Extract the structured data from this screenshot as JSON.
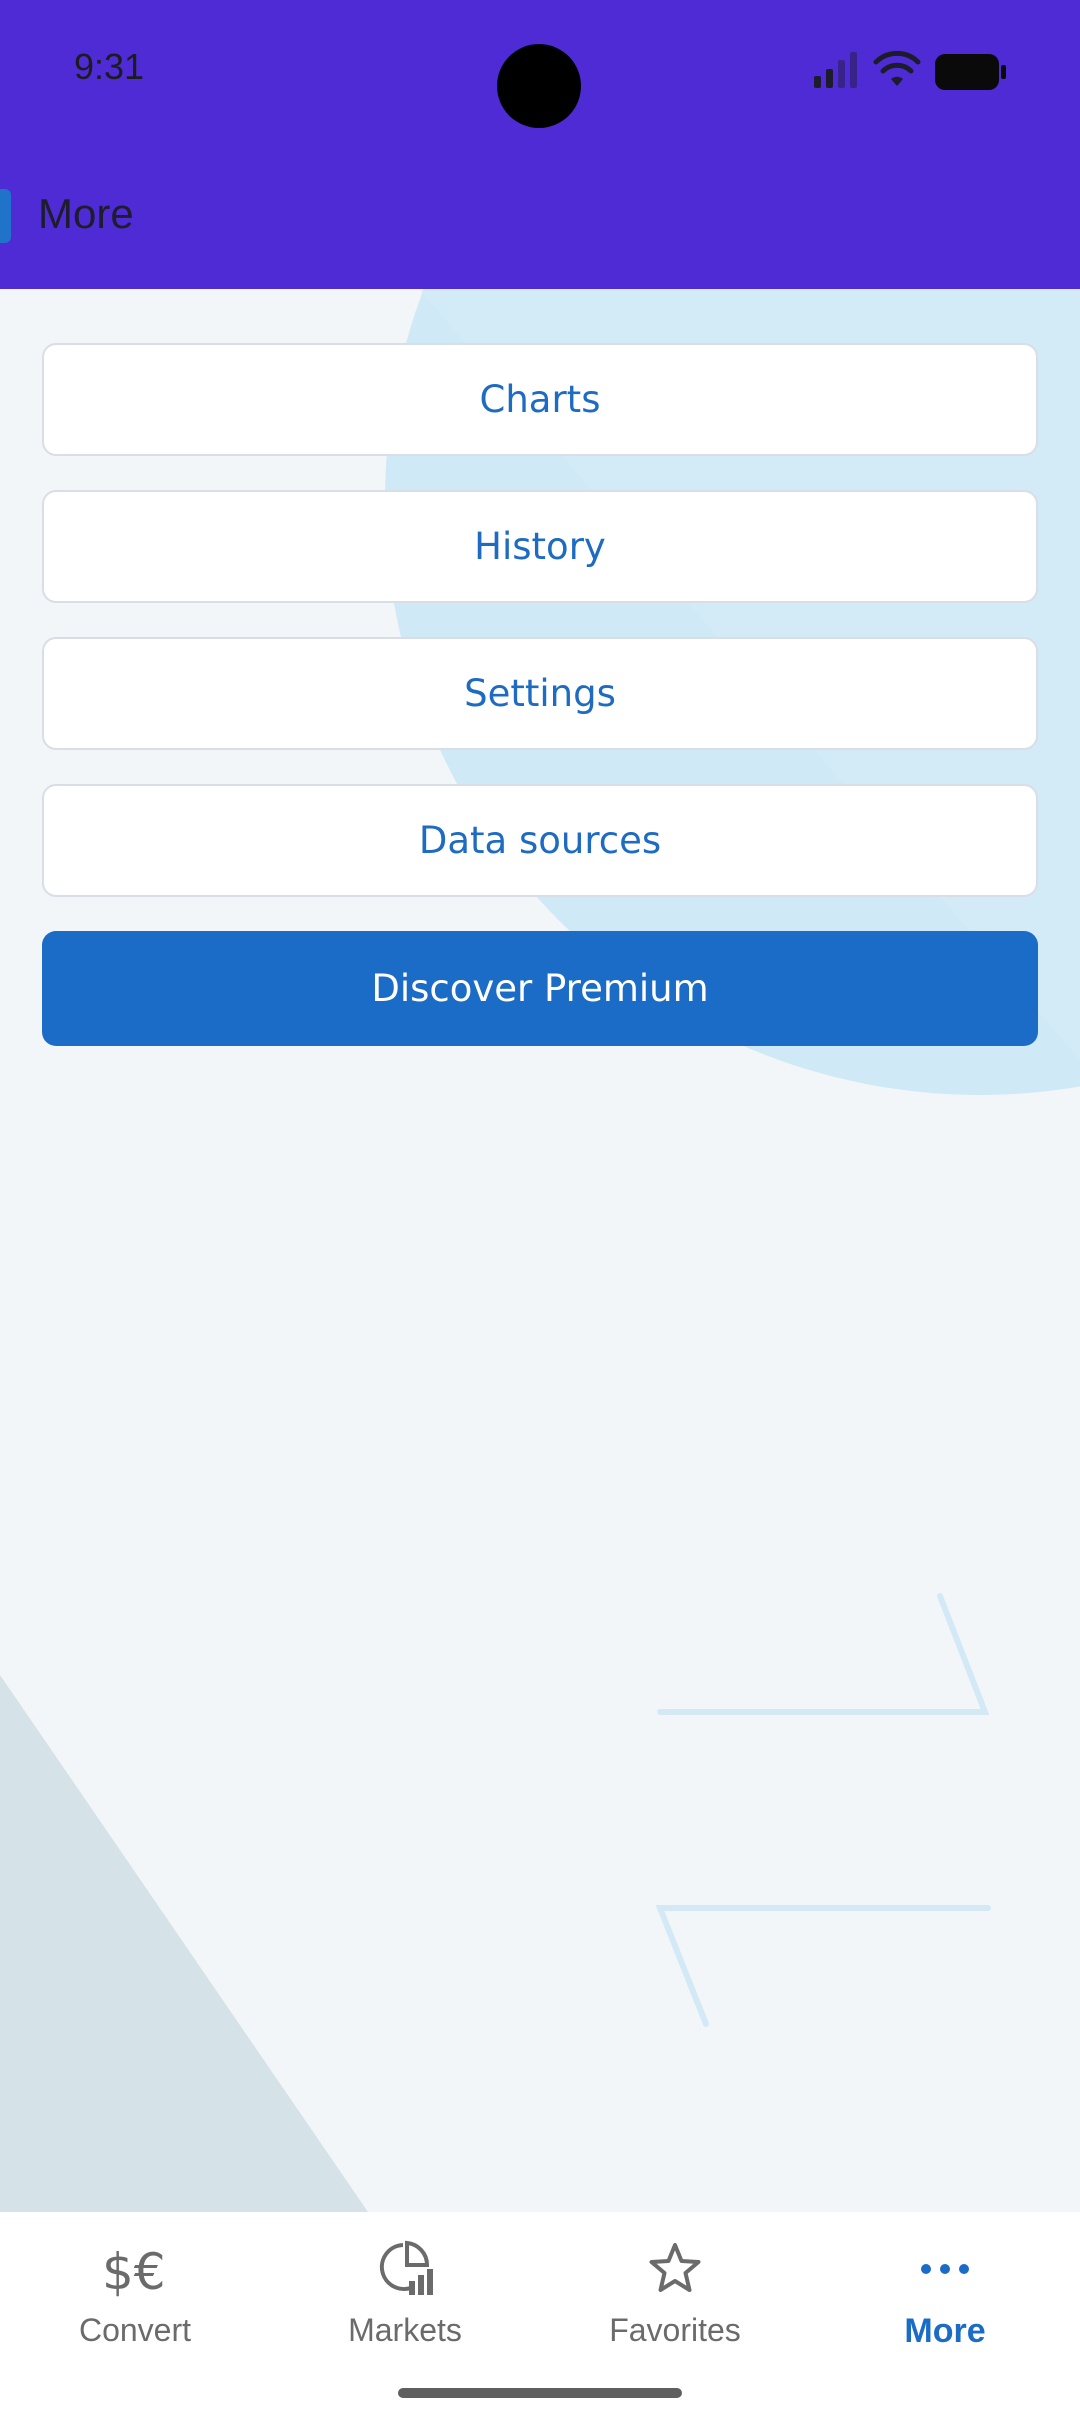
{
  "status_bar": {
    "time": "9:31"
  },
  "header": {
    "title": "More"
  },
  "menu": {
    "items": [
      {
        "label": "Charts"
      },
      {
        "label": "History"
      },
      {
        "label": "Settings"
      },
      {
        "label": "Data sources"
      }
    ],
    "premium_label": "Discover Premium"
  },
  "bottom_nav": {
    "items": [
      {
        "label": "Convert",
        "icon": "currency-exchange-icon"
      },
      {
        "label": "Markets",
        "icon": "markets-chart-icon"
      },
      {
        "label": "Favorites",
        "icon": "star-icon"
      },
      {
        "label": "More",
        "icon": "more-dots-icon",
        "active": true
      }
    ]
  },
  "colors": {
    "header_bg": "#4f2bd6",
    "accent": "#1b6cc6",
    "page_bg": "#f2f6f9",
    "deco_circle": "#cde8f5"
  }
}
